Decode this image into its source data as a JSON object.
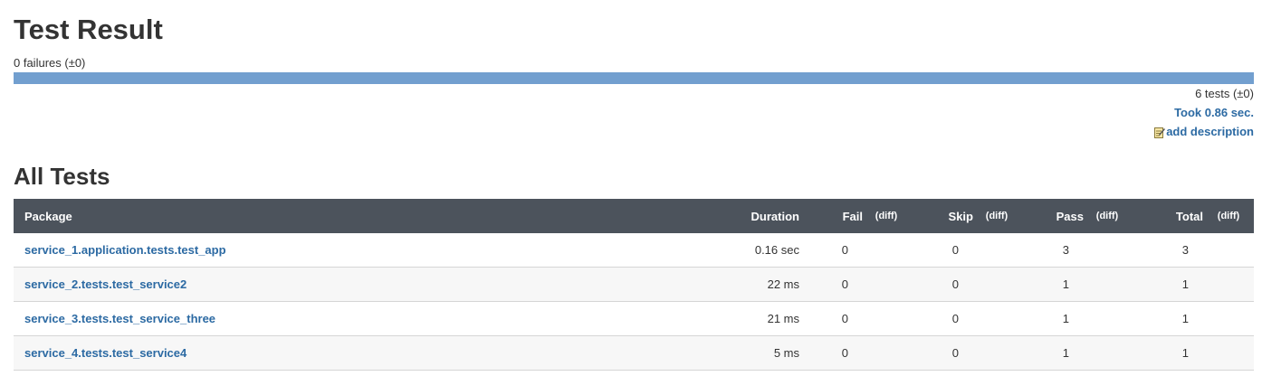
{
  "page": {
    "title": "Test Result",
    "failures_text": "0 failures (±0)",
    "pass_fraction": 1.0,
    "tests_text": "6 tests (±0)",
    "took_text": "Took 0.86 sec.",
    "add_description_label": "add description",
    "section_title": "All Tests"
  },
  "colors": {
    "header_bg": "#4c535c",
    "bar_pass": "#729fcf",
    "link": "#2c6aa3"
  },
  "icons": {
    "add_description": "edit-note-icon"
  },
  "table": {
    "headers": {
      "package": "Package",
      "duration": "Duration",
      "fail": "Fail",
      "fail_diff": "(diff)",
      "skip": "Skip",
      "skip_diff": "(diff)",
      "pass": "Pass",
      "pass_diff": "(diff)",
      "total": "Total",
      "total_diff": "(diff)"
    },
    "rows": [
      {
        "package": "service_1.application.tests.test_app",
        "duration": "0.16 sec",
        "fail": "0",
        "skip": "0",
        "pass": "3",
        "total": "3"
      },
      {
        "package": "service_2.tests.test_service2",
        "duration": "22 ms",
        "fail": "0",
        "skip": "0",
        "pass": "1",
        "total": "1"
      },
      {
        "package": "service_3.tests.test_service_three",
        "duration": "21 ms",
        "fail": "0",
        "skip": "0",
        "pass": "1",
        "total": "1"
      },
      {
        "package": "service_4.tests.test_service4",
        "duration": "5 ms",
        "fail": "0",
        "skip": "0",
        "pass": "1",
        "total": "1"
      }
    ]
  }
}
